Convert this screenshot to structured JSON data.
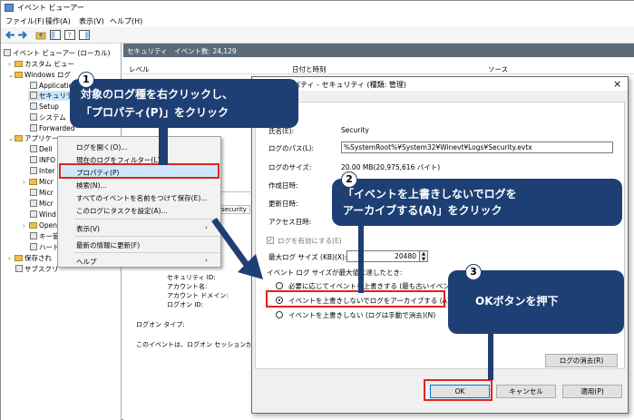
{
  "window": {
    "title": "イベント ビューアー",
    "menu": [
      "ファイル(F)",
      "操作(A)",
      "表示(V)",
      "ヘルプ(H)"
    ]
  },
  "tree": {
    "root": "イベント ビューアー (ローカル)",
    "items": [
      "カスタム ビュー",
      "Windows ログ",
      "Application",
      "セキュリティ",
      "Setup",
      "システム",
      "Forwarded",
      "アプリケーシ",
      "Dell",
      "INFO",
      "Inter",
      "Micr",
      "Micr",
      "Micr",
      "Wind",
      "Open",
      "キー管",
      "ハード",
      "保存され",
      "サブスクリ"
    ]
  },
  "list": {
    "header": "セキュリティ　イベント数: 24,129",
    "columns": [
      "レベル",
      "日付と時刻",
      "ソース"
    ],
    "details_tab": "security",
    "details": [
      "セキュリティ ID:",
      "アカウント名:",
      "アカウント ドメイン:",
      "ログオン ID:",
      "ログオン タイプ:",
      "このイベントは、ログオン セッションが破棄さ"
    ]
  },
  "context_menu": {
    "items": [
      "ログを開く(O)...",
      "現在のログをフィルター(L)...",
      "プロパティ(P)",
      "検索(N)...",
      "すべてのイベントを名前をつけて保存(E)...",
      "このログにタスクを設定(A)...",
      "表示(V)",
      "最新の情報に更新(F)",
      "ヘルプ"
    ]
  },
  "dialog": {
    "title": "ログのプロパティ - セキュリティ (種類: 管理)",
    "close_glyph": "×",
    "labels": {
      "fullname": "氏名(E):",
      "path": "ログのパス(L):",
      "size": "ログのサイズ:",
      "created": "作成日時:",
      "modified": "更新日時:",
      "accessed": "アクセス日時:",
      "enable": "ログを有効にする(E)",
      "maxsize": "最大ログ サイズ (KB)(X):",
      "policy": "イベント ログ サイズが最大値に達したとき:"
    },
    "values": {
      "fullname": "Security",
      "path": "%SystemRoot%¥System32¥Winevt¥Logs¥Security.evtx",
      "size": "20.00 MB(20,975,616 バイト)",
      "maxsize": "20480"
    },
    "radios": [
      "必要に応じてイベントを上書きする (最も古いイベントから)",
      "イベントを上書きしないでログをアーカイブする (A)",
      "イベントを上書きしない (ログは手動で消去)(N)"
    ],
    "clear_button": "ログの消去(R)",
    "ok": "OK",
    "cancel": "キャンセル",
    "apply": "適用(P)"
  },
  "callouts": {
    "c1": {
      "num": "1",
      "line1": "対象のログ種を右クリックし、",
      "line2": "「プロパティ(P)」をクリック"
    },
    "c2": {
      "num": "2",
      "line1": "「イベントを上書きしないでログを",
      "line2": "アーカイブする(A)」をクリック"
    },
    "c3": {
      "num": "3",
      "line1": "OKボタンを押下"
    }
  },
  "colors": {
    "callout": "#1e3f73",
    "highlight": "#e2231a",
    "selection": "#cce8ff"
  }
}
